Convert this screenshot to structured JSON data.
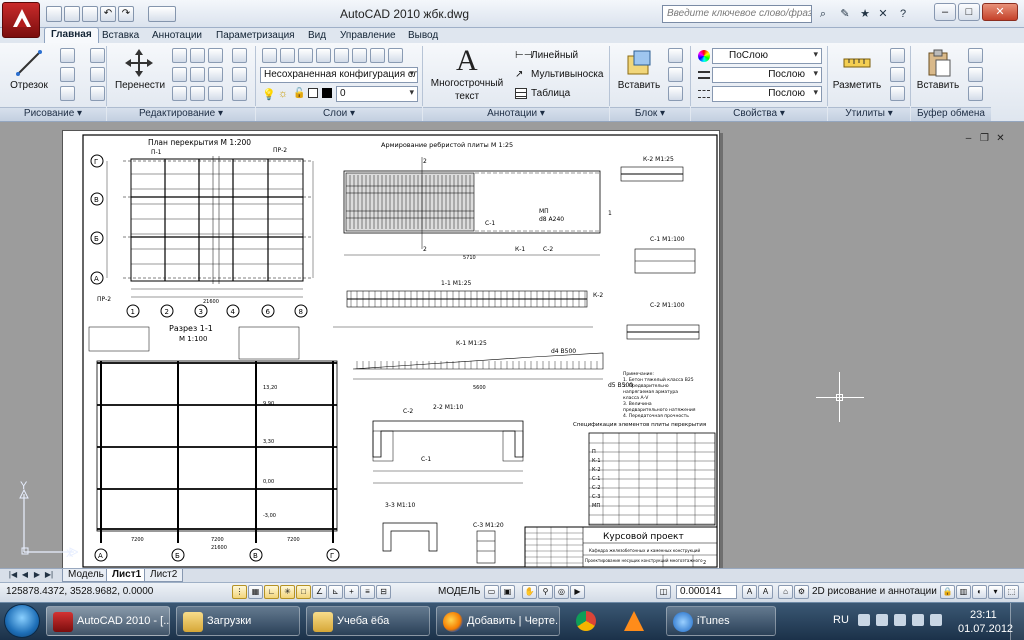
{
  "window": {
    "title": "AutoCAD 2010    жбк.dwg",
    "search_placeholder": "Введите ключевое слово/фразу",
    "minimize": "–",
    "maximize": "□",
    "close": "✕"
  },
  "ribbon": {
    "tabs": [
      "Главная",
      "Вставка",
      "Аннотации",
      "Параметризация",
      "Вид",
      "Управление",
      "Вывод"
    ],
    "panels": {
      "draw": {
        "title": "Рисование ▾",
        "line_label": "Отрезок"
      },
      "modify": {
        "title": "Редактирование ▾",
        "move_label": "Перенести"
      },
      "layers": {
        "title": "Слои ▾",
        "layer_state": "Несохраненная конфигурация сл",
        "current_layer": "0"
      },
      "annotation": {
        "title": "Аннотации ▾",
        "text_label": "Многострочный",
        "text_label2": "текст",
        "linear": "Линейный",
        "multileader": "Мультивыноска",
        "table": "Таблица"
      },
      "block": {
        "title": "Блок ▾",
        "insert_label": "Вставить"
      },
      "properties": {
        "title": "Свойства ▾",
        "color": "ПоСлою",
        "linetype": "Послою",
        "lineweight": "Послою"
      },
      "utilities": {
        "title": "Утилиты ▾",
        "measure_label": "Разметить"
      },
      "clipboard": {
        "title": "Буфер обмена",
        "paste_label": "Вставить"
      }
    }
  },
  "drawing": {
    "plan_title": "План перекрытия М 1:200",
    "slab_title": "Армирование ребристой плиты М 1:25",
    "section11_title": "Разрез 1-1",
    "section11_scale": "М 1:100",
    "cut11_label": "1-1 М1:25",
    "k2_label": "К-2 М1:25",
    "c1_label": "С-1 М1:100",
    "c2_label": "С-2 М1:100",
    "k1_label": "К-1 М1:25",
    "s22_label": "2-2 М1:10",
    "s33_label": "3-3 М1:10",
    "c3_label": "С-3 М1:20",
    "spec_title": "Спецификация элементов плиты перекрытия",
    "stamp_title": "Курсовой проект",
    "stamp_sub": "Кафедра железобетонных и каменных конструкций",
    "stamp_sub2": "Проектирование несущих конструкций многоэтажного",
    "stamp_sheet": "2",
    "axes_letters": [
      "Г",
      "В",
      "Б",
      "А"
    ],
    "axes_numbers": [
      "1",
      "2",
      "3",
      "4",
      "5",
      "6",
      "7",
      "8"
    ],
    "section_axes": [
      "А",
      "Б",
      "В",
      "Г"
    ],
    "dims": {
      "span1": "7200",
      "span2": "7200",
      "span3": "7200",
      "total": "21600",
      "slab_len": "5710",
      "k1_len": "5600"
    },
    "levels": [
      "13,20",
      "9,90",
      "6,60",
      "3,30",
      "0,00",
      "-3,00"
    ],
    "notes": [
      "Примечание:",
      "1. Бетон тяжелый класса В25",
      "2. Предварительно",
      "напрягаемая арматура",
      "класса А-V",
      "3. Величина",
      "предварительного натяжения",
      "4. Передаточная прочность"
    ],
    "spec_rows": [
      "П",
      "К-1",
      "К-2",
      "С-1",
      "С-2",
      "С-3",
      "МП"
    ],
    "c1_word": "С-1",
    "k1_word": "К-1",
    "c2_word": "С-2",
    "mp_word": "МП",
    "rebar_note": "d8 A240",
    "k1_rebar": "d4 B500",
    "k1_rebar2": "d5 B500",
    "pr_label": "ПР-2",
    "p1_label": "П-1"
  },
  "layout_tabs": [
    "Модель",
    "Лист1",
    "Лист2"
  ],
  "status": {
    "coords": "125878.4372, 3528.9682, 0.0000",
    "space": "МОДЕЛЬ",
    "scale": "0.000141",
    "workspace": "2D рисование и аннотации"
  },
  "taskbar": {
    "items": [
      "AutoCAD 2010 - [...",
      "Загрузки",
      "Учеба ёба",
      "Добавить | Черте...",
      "iTunes"
    ],
    "lang": "RU",
    "time": "23:11",
    "date": "01.07.2012"
  },
  "ucs": {
    "x": "X",
    "y": "Y"
  },
  "colors": {
    "accent": "#3d6db3",
    "autocad_red": "#b31b1b",
    "paper": "#ffffff",
    "model_bg": "#9c9c9c"
  }
}
